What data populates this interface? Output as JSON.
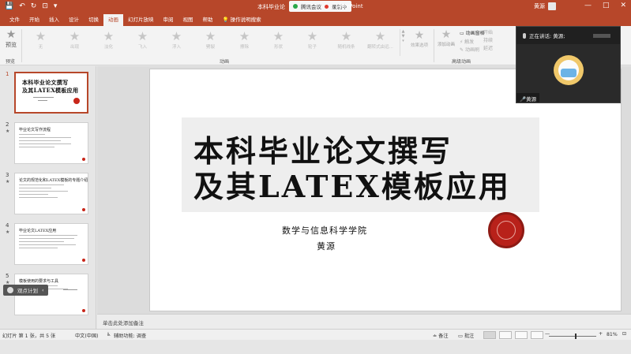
{
  "titlebar": {
    "doc_title_head": "本科毕业论",
    "meeting_name": "腾讯会议",
    "recording": "录制中",
    "app_tail": "owerPoint",
    "user_name": "黄源",
    "min_icon": "—",
    "max_icon": "□",
    "close_icon": "✕",
    "qat": [
      "💾",
      "↶",
      "↻",
      "⊡",
      "▾"
    ]
  },
  "tabs": [
    {
      "label": "文件",
      "active": false
    },
    {
      "label": "开始",
      "active": false
    },
    {
      "label": "插入",
      "active": false
    },
    {
      "label": "设计",
      "active": false
    },
    {
      "label": "切换",
      "active": false
    },
    {
      "label": "动画",
      "active": true
    },
    {
      "label": "幻灯片放映",
      "active": false
    },
    {
      "label": "审阅",
      "active": false
    },
    {
      "label": "视图",
      "active": false
    },
    {
      "label": "帮助",
      "active": false
    },
    {
      "label": "操作说明搜索",
      "active": false,
      "bulb": true
    }
  ],
  "ribbon": {
    "preview_label": "预览",
    "preview_group": "预览",
    "animation_group": "动画",
    "advanced_group": "高级动画",
    "effects": [
      "无",
      "出现",
      "淡化",
      "飞入",
      "浮入",
      "劈裂",
      "擦除",
      "形状",
      "轮子",
      "随机线条",
      "翻转式由远..."
    ],
    "effect_options": "效果选项",
    "add_animation": "添加动画",
    "animation_pane": "动画窗格",
    "trigger": "触发",
    "painter": "动画刷",
    "timing": [
      "开始",
      "持续",
      "延迟"
    ]
  },
  "thumbnails": [
    {
      "num": "1",
      "title": "本科毕业论文撰写",
      "title2": "及其LATEX模板应用",
      "selected": true
    },
    {
      "num": "2",
      "title": "毕业论文写作流程",
      "selected": false
    },
    {
      "num": "3",
      "title": "论文的规范化和LATEX模板的专题介绍",
      "selected": false
    },
    {
      "num": "4",
      "title": "毕业论文LATEX应用",
      "selected": false
    },
    {
      "num": "5",
      "title": "模板使用的要求与工具",
      "selected": false
    }
  ],
  "tooltip_chip": "观点计划",
  "slide": {
    "title_line1": "本科毕业论文撰写",
    "title_line2": "及其LATEX模板应用",
    "subtitle": "数学与信息科学学院",
    "author": "黄源"
  },
  "video": {
    "speaking": "正在讲话: 黄源;",
    "participant": "黄源"
  },
  "notes_placeholder": "单击此处添加备注",
  "status": {
    "slide_info": "幻灯片 第 1 张，共 5 张",
    "language": "中文(中国)",
    "accessibility": "辅助功能: 调查",
    "notes": "备注",
    "comments": "批注",
    "zoom_minus": "—",
    "zoom_plus": "+",
    "zoom": "81%",
    "zoom_value": 0.55
  },
  "colors": {
    "accent": "#b7472a",
    "seal": "#b8211a"
  }
}
